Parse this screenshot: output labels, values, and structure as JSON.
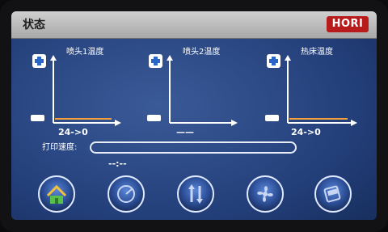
{
  "header": {
    "title": "状态",
    "brand": "HORI"
  },
  "gauges": [
    {
      "label": "喷头1温度",
      "value": "24->0"
    },
    {
      "label": "喷头2温度",
      "value": "——"
    },
    {
      "label": "热床温度",
      "value": "24->0"
    }
  ],
  "print_speed": {
    "label": "打印速度:",
    "value": "--:--"
  },
  "colors": {
    "trace": "#f2a03a",
    "accent": "#b71b1b"
  },
  "nav": [
    {
      "icon": "home-icon"
    },
    {
      "icon": "speed-icon"
    },
    {
      "icon": "move-icon"
    },
    {
      "icon": "fan-icon"
    },
    {
      "icon": "file-icon"
    }
  ]
}
